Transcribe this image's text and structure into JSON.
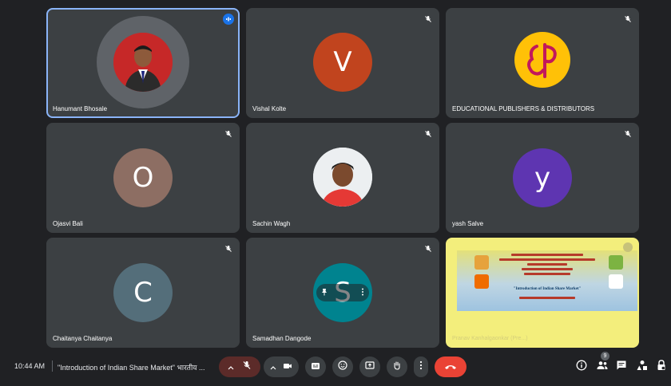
{
  "participants": [
    {
      "name": "Hanumant Bhosale",
      "kind": "photo",
      "speaking": true
    },
    {
      "name": "Vishal Kolte",
      "kind": "initial",
      "initial": "V",
      "color": "#c1441e"
    },
    {
      "name": "EDUCATIONAL PUBLISHERS & DISTRIBUTORS",
      "kind": "logo"
    },
    {
      "name": "Ojasvi Bali",
      "kind": "initial",
      "initial": "O",
      "color": "#8d6e63"
    },
    {
      "name": "Sachin Wagh",
      "kind": "photo"
    },
    {
      "name": "yash Salve",
      "kind": "initial",
      "initial": "y",
      "color": "#5e35b1"
    },
    {
      "name": "Chaitanya Chaitanya",
      "kind": "initial",
      "initial": "C",
      "color": "#546e7a"
    },
    {
      "name": "Samadhan Dangode",
      "kind": "initial",
      "initial": "S",
      "color": "#00838f",
      "pinned": true
    },
    {
      "name": "Pranav Kanhalgaonkar (Pre...)",
      "kind": "presentation"
    }
  ],
  "slide": {
    "title": "\"Introduction of Indian Share Market\""
  },
  "bottom_bar": {
    "time": "10:44 AM",
    "separator": "|",
    "meeting_title": "\"Introduction of Indian Share Market\" भारतीय ..."
  },
  "controls": {
    "icons": [
      "chevron-up-icon",
      "mic-off-icon",
      "chevron-up-icon",
      "camera-icon",
      "captions-icon",
      "emoji-icon",
      "present-icon",
      "raise-hand-icon",
      "more-options-icon",
      "end-call-icon"
    ],
    "right_icons": [
      "info-icon",
      "people-icon",
      "chat-icon",
      "activities-icon",
      "lock-icon"
    ],
    "people_count": "9"
  },
  "colors": {
    "background": "#202124",
    "tile": "#3c4043",
    "active_outline": "#8ab4f8",
    "end_call": "#ea4335",
    "mic_muted_bg": "#5c2b29"
  }
}
